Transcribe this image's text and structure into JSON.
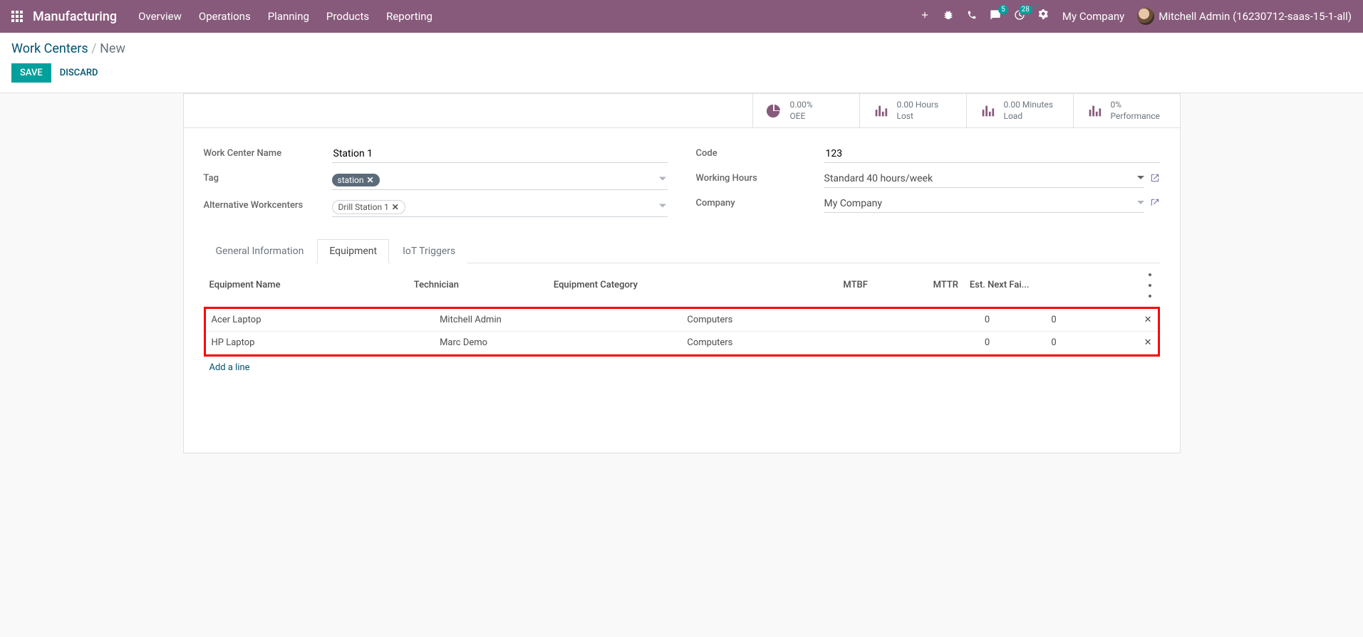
{
  "nav": {
    "brand": "Manufacturing",
    "menu": [
      "Overview",
      "Operations",
      "Planning",
      "Products",
      "Reporting"
    ],
    "msg_badge": "5",
    "activity_badge": "28",
    "company": "My Company",
    "user": "Mitchell Admin (16230712-saas-15-1-all)"
  },
  "breadcrumb": {
    "parent": "Work Centers",
    "current": "New"
  },
  "buttons": {
    "save": "SAVE",
    "discard": "DISCARD"
  },
  "stats": {
    "oee_val": "0.00%",
    "oee_lbl": "OEE",
    "lost_val": "0.00 Hours",
    "lost_lbl": "Lost",
    "load_val": "0.00 Minutes",
    "load_lbl": "Load",
    "perf_val": "0%",
    "perf_lbl": "Performance"
  },
  "fields": {
    "name_lbl": "Work Center Name",
    "name_val": "Station 1",
    "tag_lbl": "Tag",
    "tag_val": "station",
    "alt_lbl": "Alternative Workcenters",
    "alt_val": "Drill Station 1",
    "code_lbl": "Code",
    "code_val": "123",
    "wh_lbl": "Working Hours",
    "wh_val": "Standard 40 hours/week",
    "company_lbl": "Company",
    "company_val": "My Company"
  },
  "tabs": {
    "t0": "General Information",
    "t1": "Equipment",
    "t2": "IoT Triggers"
  },
  "table": {
    "h_name": "Equipment Name",
    "h_tech": "Technician",
    "h_cat": "Equipment Category",
    "h_mtbf": "MTBF",
    "h_mttr": "MTTR",
    "h_est": "Est. Next Fai...",
    "rows": [
      {
        "name": "Acer Laptop",
        "tech": "Mitchell Admin",
        "cat": "Computers",
        "mtbf": "0",
        "mttr": "0",
        "est": ""
      },
      {
        "name": "HP Laptop",
        "tech": "Marc Demo",
        "cat": "Computers",
        "mtbf": "0",
        "mttr": "0",
        "est": ""
      }
    ],
    "add": "Add a line"
  }
}
